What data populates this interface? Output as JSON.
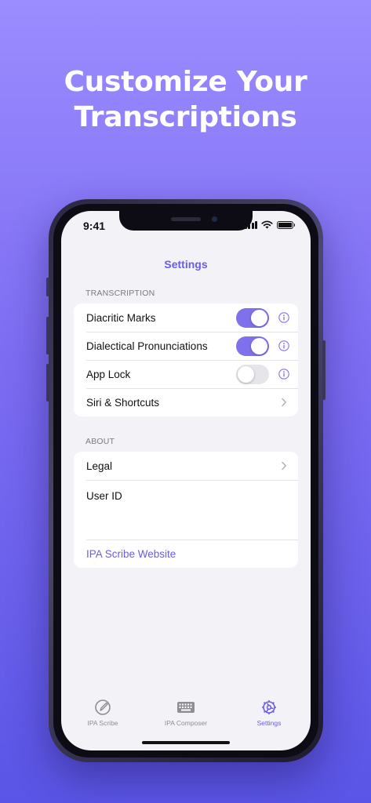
{
  "headline": {
    "line1": "Customize Your",
    "line2": "Transcriptions"
  },
  "status_bar": {
    "time": "9:41",
    "icons": [
      "cellular-signal-icon",
      "wifi-icon",
      "battery-icon"
    ]
  },
  "nav": {
    "title": "Settings"
  },
  "transcription_section": {
    "header": "TRANSCRIPTION",
    "rows": [
      {
        "label": "Diacritic Marks",
        "toggle_on": true,
        "icon": "info-icon"
      },
      {
        "label": "Dialectical Pronunciations",
        "toggle_on": true,
        "icon": "info-icon"
      },
      {
        "label": "App Lock",
        "toggle_on": false,
        "icon": "info-icon"
      },
      {
        "label": "Siri & Shortcuts",
        "icon": "chevron-right-icon"
      }
    ]
  },
  "about_section": {
    "header": "ABOUT",
    "rows": [
      {
        "label": "Legal",
        "icon": "chevron-right-icon"
      },
      {
        "label": "User ID"
      },
      {
        "label": "IPA Scribe Website"
      }
    ]
  },
  "tab_bar": {
    "tabs": [
      {
        "label": "IPA Scribe",
        "icon": "pencil-circle-icon",
        "active": false
      },
      {
        "label": "IPA Composer",
        "icon": "keyboard-icon",
        "active": false
      },
      {
        "label": "Settings",
        "icon": "gear-icon",
        "active": true
      }
    ]
  },
  "colors": {
    "accent": "#7f70ec",
    "accent_text": "#6a5ce6",
    "background_top": "#9b8cff",
    "background_bottom": "#5a55e6"
  }
}
